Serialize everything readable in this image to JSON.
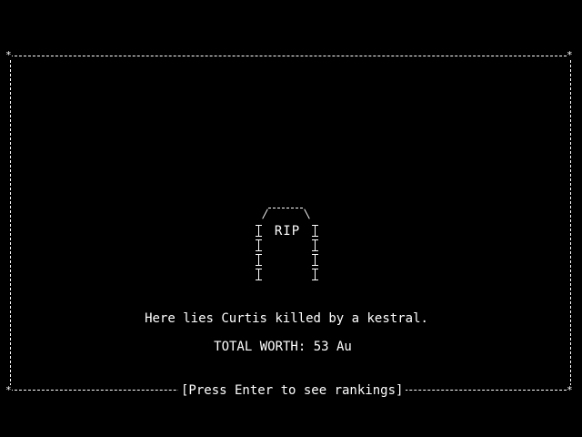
{
  "screen": {
    "background": "#000000",
    "foreground": "#ffffff"
  },
  "frame": {
    "corner_glyph": "*"
  },
  "tombstone": {
    "label": "RIP"
  },
  "epitaph": {
    "death_message": "Here lies Curtis killed by a kestral.",
    "total_worth": "TOTAL WORTH: 53 Au"
  },
  "footer": {
    "prompt": "[Press Enter to see rankings]"
  }
}
